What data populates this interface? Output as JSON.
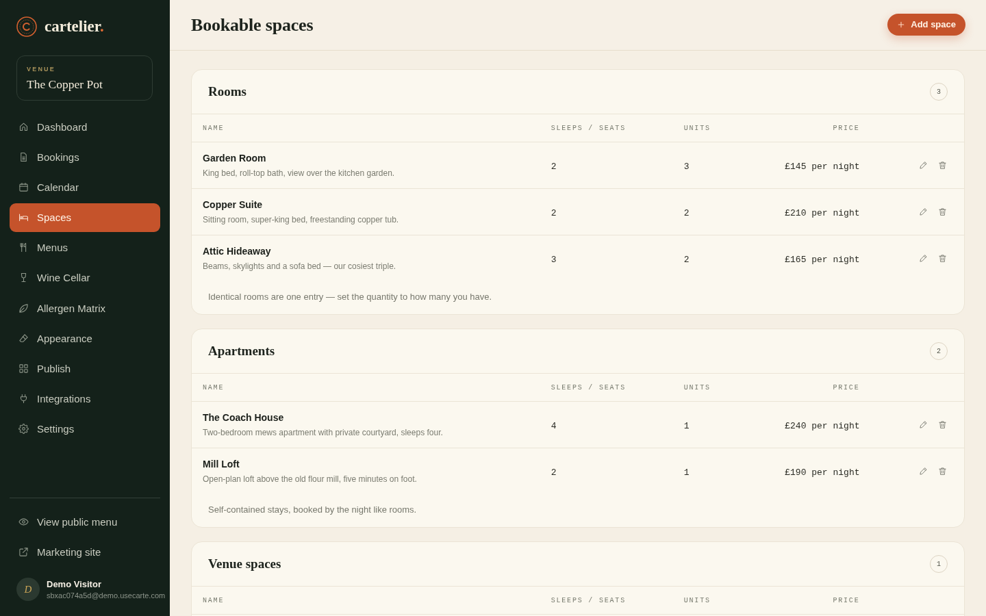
{
  "sidebar": {
    "brand": {
      "name": "cartelier",
      "dot": "."
    },
    "venue": {
      "label": "VENUE",
      "name": "The Copper Pot"
    },
    "nav": [
      {
        "label": "Dashboard",
        "selected": false
      },
      {
        "label": "Bookings",
        "selected": false
      },
      {
        "label": "Calendar",
        "selected": false
      },
      {
        "label": "Spaces",
        "selected": true
      },
      {
        "label": "Menus",
        "selected": false
      },
      {
        "label": "Wine Cellar",
        "selected": false
      },
      {
        "label": "Allergen Matrix",
        "selected": false
      },
      {
        "label": "Appearance",
        "selected": false
      },
      {
        "label": "Publish",
        "selected": false
      },
      {
        "label": "Integrations",
        "selected": false
      },
      {
        "label": "Settings",
        "selected": false
      }
    ],
    "links": [
      {
        "label": "View public menu"
      },
      {
        "label": "Marketing site"
      }
    ],
    "user": {
      "initial": "D",
      "name": "Demo Visitor",
      "email": "sbxac074a5d@demo.usecarte.com"
    }
  },
  "header": {
    "title": "Bookable spaces",
    "add_button": {
      "label": "Add space"
    }
  },
  "sections": [
    {
      "title": "Rooms",
      "count": "3",
      "columns": [
        "NAME",
        "SLEEPS / SEATS",
        "UNITS",
        "PRICE"
      ],
      "rows": [
        {
          "name": "Garden Room",
          "description": "King bed, roll-top bath, view over the kitchen garden.",
          "sleeps": "2",
          "units": "3",
          "price": "£145 per night"
        },
        {
          "name": "Copper Suite",
          "description": "Sitting room, super-king bed, freestanding copper tub.",
          "sleeps": "2",
          "units": "2",
          "price": "£210 per night"
        },
        {
          "name": "Attic Hideaway",
          "description": "Beams, skylights and a sofa bed — our cosiest triple.",
          "sleeps": "3",
          "units": "2",
          "price": "£165 per night"
        }
      ],
      "note": "Identical rooms are one entry — set the quantity to how many you have."
    },
    {
      "title": "Apartments",
      "count": "2",
      "columns": [
        "NAME",
        "SLEEPS / SEATS",
        "UNITS",
        "PRICE"
      ],
      "rows": [
        {
          "name": "The Coach House",
          "description": "Two-bedroom mews apartment with private courtyard, sleeps four.",
          "sleeps": "4",
          "units": "1",
          "price": "£240 per night"
        },
        {
          "name": "Mill Loft",
          "description": "Open-plan loft above the old flour mill, five minutes on foot.",
          "sleeps": "2",
          "units": "1",
          "price": "£190 per night"
        }
      ],
      "note": "Self-contained stays, booked by the night like rooms."
    },
    {
      "title": "Venue spaces",
      "count": "1",
      "columns": [
        "NAME",
        "SLEEPS / SEATS",
        "UNITS",
        "PRICE"
      ]
    }
  ]
}
